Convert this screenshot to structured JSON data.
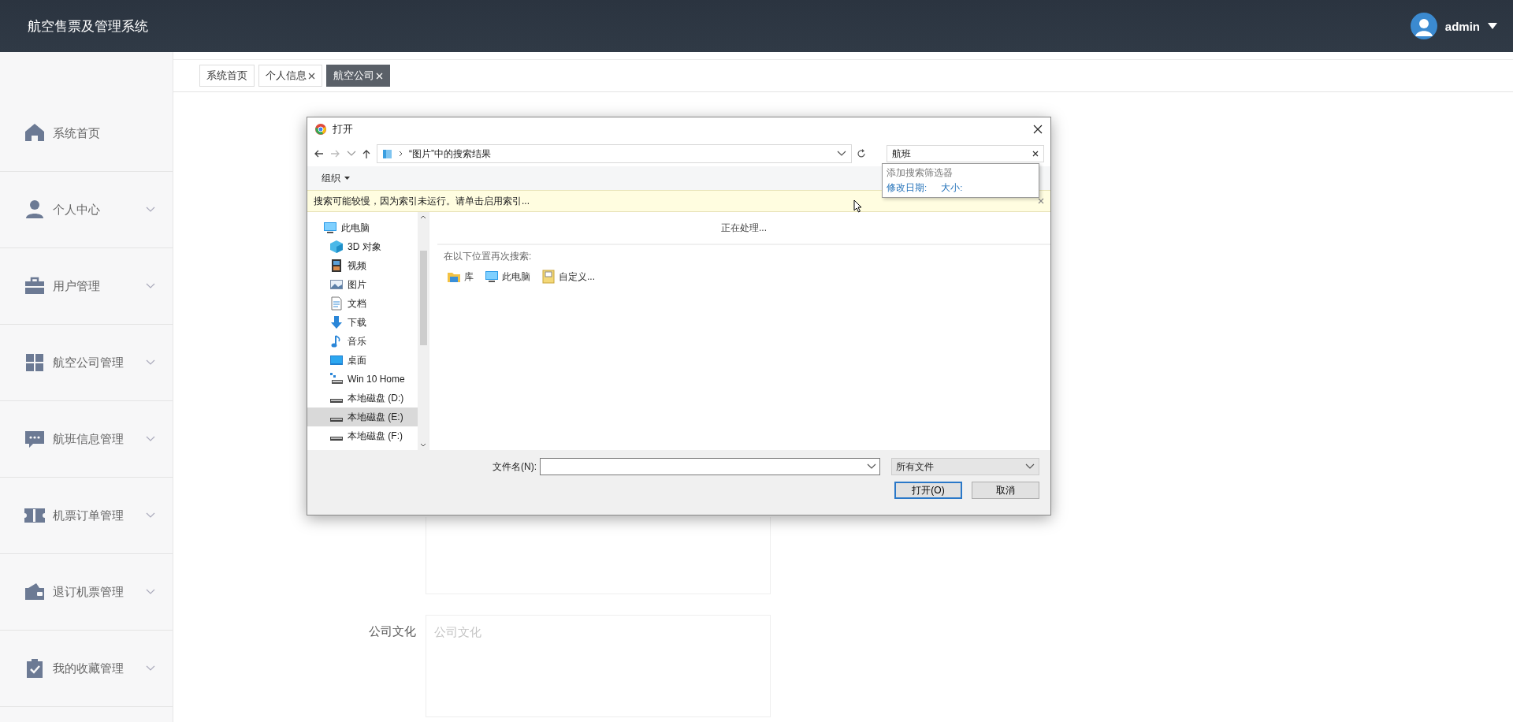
{
  "app": {
    "title": "航空售票及管理系统",
    "user": "admin"
  },
  "tabs": [
    {
      "label": "系统首页",
      "closable": false,
      "selected": false
    },
    {
      "label": "个人信息",
      "closable": true,
      "selected": false
    },
    {
      "label": "航空公司",
      "closable": true,
      "selected": true
    }
  ],
  "sidebar": {
    "items": [
      {
        "label": "系统首页",
        "kind": "home",
        "expandable": false
      },
      {
        "label": "个人中心",
        "kind": "person",
        "expandable": true
      },
      {
        "label": "用户管理",
        "kind": "briefcase",
        "expandable": true
      },
      {
        "label": "航空公司管理",
        "kind": "grid",
        "expandable": true
      },
      {
        "label": "航班信息管理",
        "kind": "chat",
        "expandable": true
      },
      {
        "label": "机票订单管理",
        "kind": "ticket",
        "expandable": true
      },
      {
        "label": "退订机票管理",
        "kind": "wallet",
        "expandable": true
      },
      {
        "label": "我的收藏管理",
        "kind": "clipboard",
        "expandable": true
      }
    ]
  },
  "form": {
    "fields": [
      {
        "label": "公司文化",
        "placeholder": "公司文化"
      }
    ]
  },
  "dialog": {
    "title": "打开",
    "path": "“图片”中的搜索结果",
    "search": "航班",
    "organize": "组织",
    "search_filter": {
      "heading": "添加搜索筛选器",
      "filters": [
        "修改日期:",
        "大小:"
      ]
    },
    "info_bar": "搜索可能较慢，因为索引未运行。请单击启用索引...",
    "tree": [
      {
        "label": "此电脑",
        "kind": "pc",
        "selected": false,
        "children": [
          {
            "label": "3D 对象",
            "kind": "cube",
            "selected": false
          },
          {
            "label": "视频",
            "kind": "film",
            "selected": false
          },
          {
            "label": "图片",
            "kind": "image",
            "selected": false
          },
          {
            "label": "文档",
            "kind": "doc",
            "selected": false
          },
          {
            "label": "下载",
            "kind": "download",
            "selected": false
          },
          {
            "label": "音乐",
            "kind": "music",
            "selected": false
          },
          {
            "label": "桌面",
            "kind": "desktop",
            "selected": false
          },
          {
            "label": "Win 10 Home",
            "kind": "netdrive",
            "selected": false
          },
          {
            "label": "本地磁盘 (D:)",
            "kind": "drive",
            "selected": false
          },
          {
            "label": "本地磁盘 (E:)",
            "kind": "drive",
            "selected": true
          },
          {
            "label": "本地磁盘 (F:)",
            "kind": "drive",
            "selected": false
          }
        ]
      }
    ],
    "status": "正在处理...",
    "search_again": {
      "label": "在以下位置再次搜索:",
      "locations": [
        {
          "label": "库",
          "kind": "library"
        },
        {
          "label": "此电脑",
          "kind": "pc"
        },
        {
          "label": "自定义...",
          "kind": "custom"
        }
      ]
    },
    "filename_label": "文件名(N):",
    "filetype": "所有文件",
    "buttons": [
      {
        "label": "打开(O)",
        "default": true
      },
      {
        "label": "取消",
        "default": false
      }
    ]
  }
}
